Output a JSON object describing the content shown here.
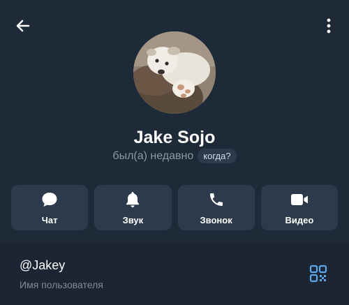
{
  "header": {
    "back_icon": "arrow-left-icon",
    "menu_icon": "more-vertical-icon"
  },
  "profile": {
    "name": "Jake Sojo",
    "status": "был(а) недавно",
    "when_badge": "когда?"
  },
  "actions": [
    {
      "label": "Чат",
      "icon": "chat-bubble-icon"
    },
    {
      "label": "Звук",
      "icon": "bell-icon"
    },
    {
      "label": "Звонок",
      "icon": "phone-icon"
    },
    {
      "label": "Видео",
      "icon": "video-camera-icon"
    }
  ],
  "info": {
    "username": "@Jakey",
    "username_caption": "Имя пользователя",
    "qr_icon": "qr-code-icon"
  },
  "colors": {
    "background": "#1f2a38",
    "card": "#2c3a4c",
    "info_background": "#1b2533",
    "muted_text": "#8c98a6",
    "accent": "#5aa8e6"
  }
}
